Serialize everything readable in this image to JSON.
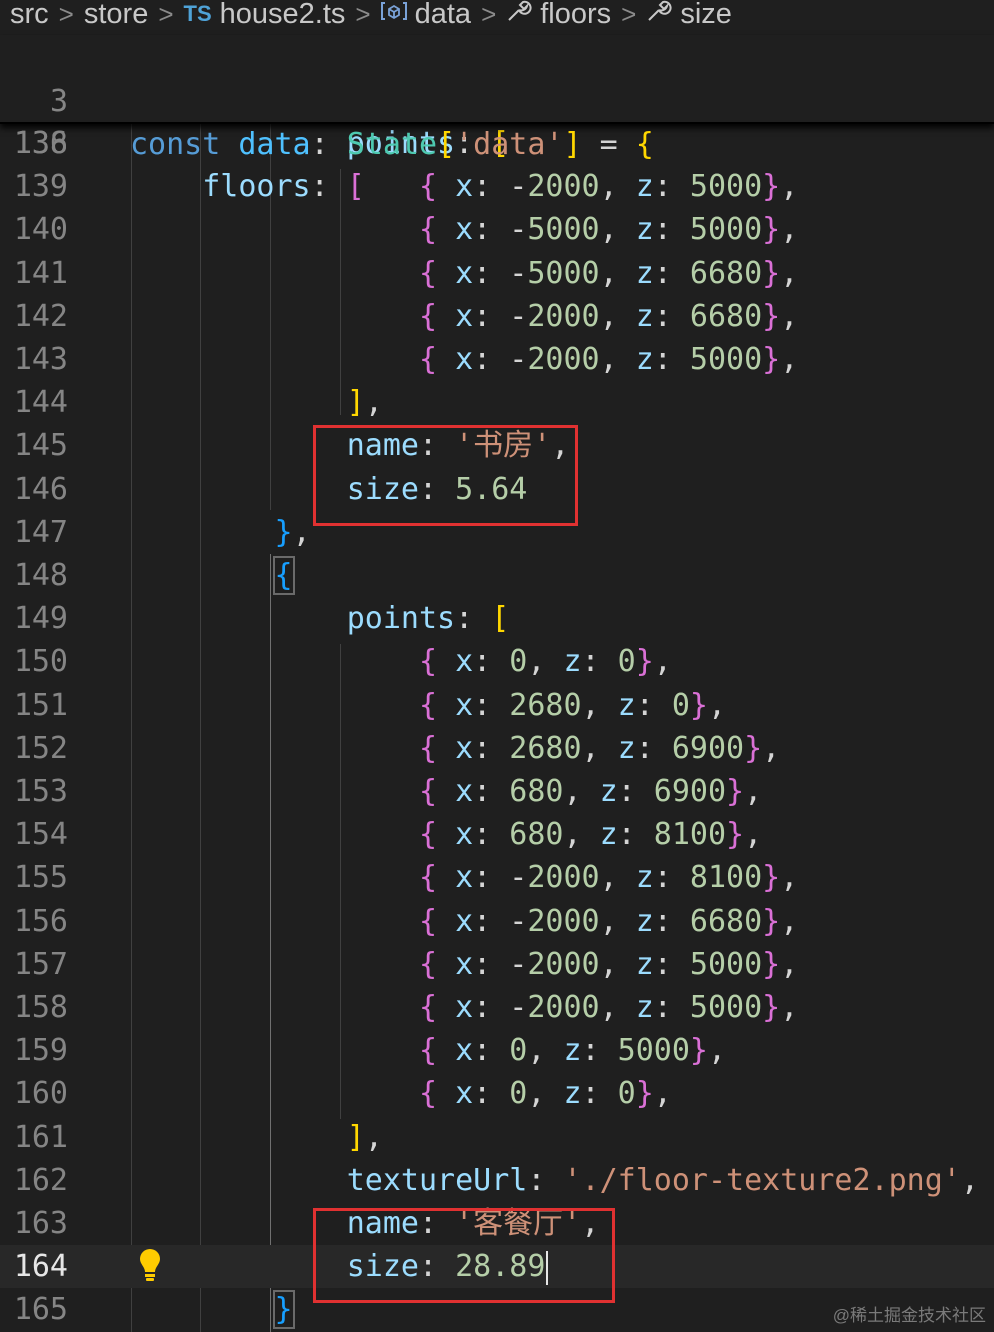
{
  "breadcrumb": {
    "items": [
      "src",
      "store",
      "house2.ts",
      "data",
      "floors",
      "size"
    ],
    "ts_badge": "TS"
  },
  "sticky_lines": [
    {
      "ln": "3",
      "code": "const data: State['data'] = {"
    },
    {
      "ln": "136",
      "code": "floors: ["
    }
  ],
  "editor": {
    "active_line": "164",
    "lines": [
      {
        "ln": "138",
        "text": "points: ["
      },
      {
        "ln": "139",
        "text": "{ x: -2000, z: 5000},"
      },
      {
        "ln": "140",
        "text": "{ x: -5000, z: 5000},"
      },
      {
        "ln": "141",
        "text": "{ x: -5000, z: 6680},"
      },
      {
        "ln": "142",
        "text": "{ x: -2000, z: 6680},"
      },
      {
        "ln": "143",
        "text": "{ x: -2000, z: 5000},"
      },
      {
        "ln": "144",
        "text": "],"
      },
      {
        "ln": "145",
        "text": "name: '书房',"
      },
      {
        "ln": "146",
        "text": "size: 5.64"
      },
      {
        "ln": "147",
        "text": "},"
      },
      {
        "ln": "148",
        "text": "{"
      },
      {
        "ln": "149",
        "text": "points: ["
      },
      {
        "ln": "150",
        "text": "{ x: 0, z: 0},"
      },
      {
        "ln": "151",
        "text": "{ x: 2680, z: 0},"
      },
      {
        "ln": "152",
        "text": "{ x: 2680, z: 6900},"
      },
      {
        "ln": "153",
        "text": "{ x: 680, z: 6900},"
      },
      {
        "ln": "154",
        "text": "{ x: 680, z: 8100},"
      },
      {
        "ln": "155",
        "text": "{ x: -2000, z: 8100},"
      },
      {
        "ln": "156",
        "text": "{ x: -2000, z: 6680},"
      },
      {
        "ln": "157",
        "text": "{ x: -2000, z: 5000},"
      },
      {
        "ln": "158",
        "text": "{ x: -2000, z: 5000},"
      },
      {
        "ln": "159",
        "text": "{ x: 0, z: 5000},"
      },
      {
        "ln": "160",
        "text": "{ x: 0, z: 0},"
      },
      {
        "ln": "161",
        "text": "],"
      },
      {
        "ln": "162",
        "text": "textureUrl: './floor-texture2.png',"
      },
      {
        "ln": "163",
        "text": "name: '客餐厅',"
      },
      {
        "ln": "164",
        "text": "size: 28.89"
      },
      {
        "ln": "165",
        "text": "}"
      }
    ]
  },
  "colors": {
    "highlight_box": "#e03131",
    "background": "#1f1f1f"
  },
  "icons": {
    "lightbulb": "lightbulb-icon",
    "symbol_variable": "symbol-variable-icon",
    "symbol_property": "wrench-icon"
  },
  "watermark": "@稀土掘金技术社区"
}
